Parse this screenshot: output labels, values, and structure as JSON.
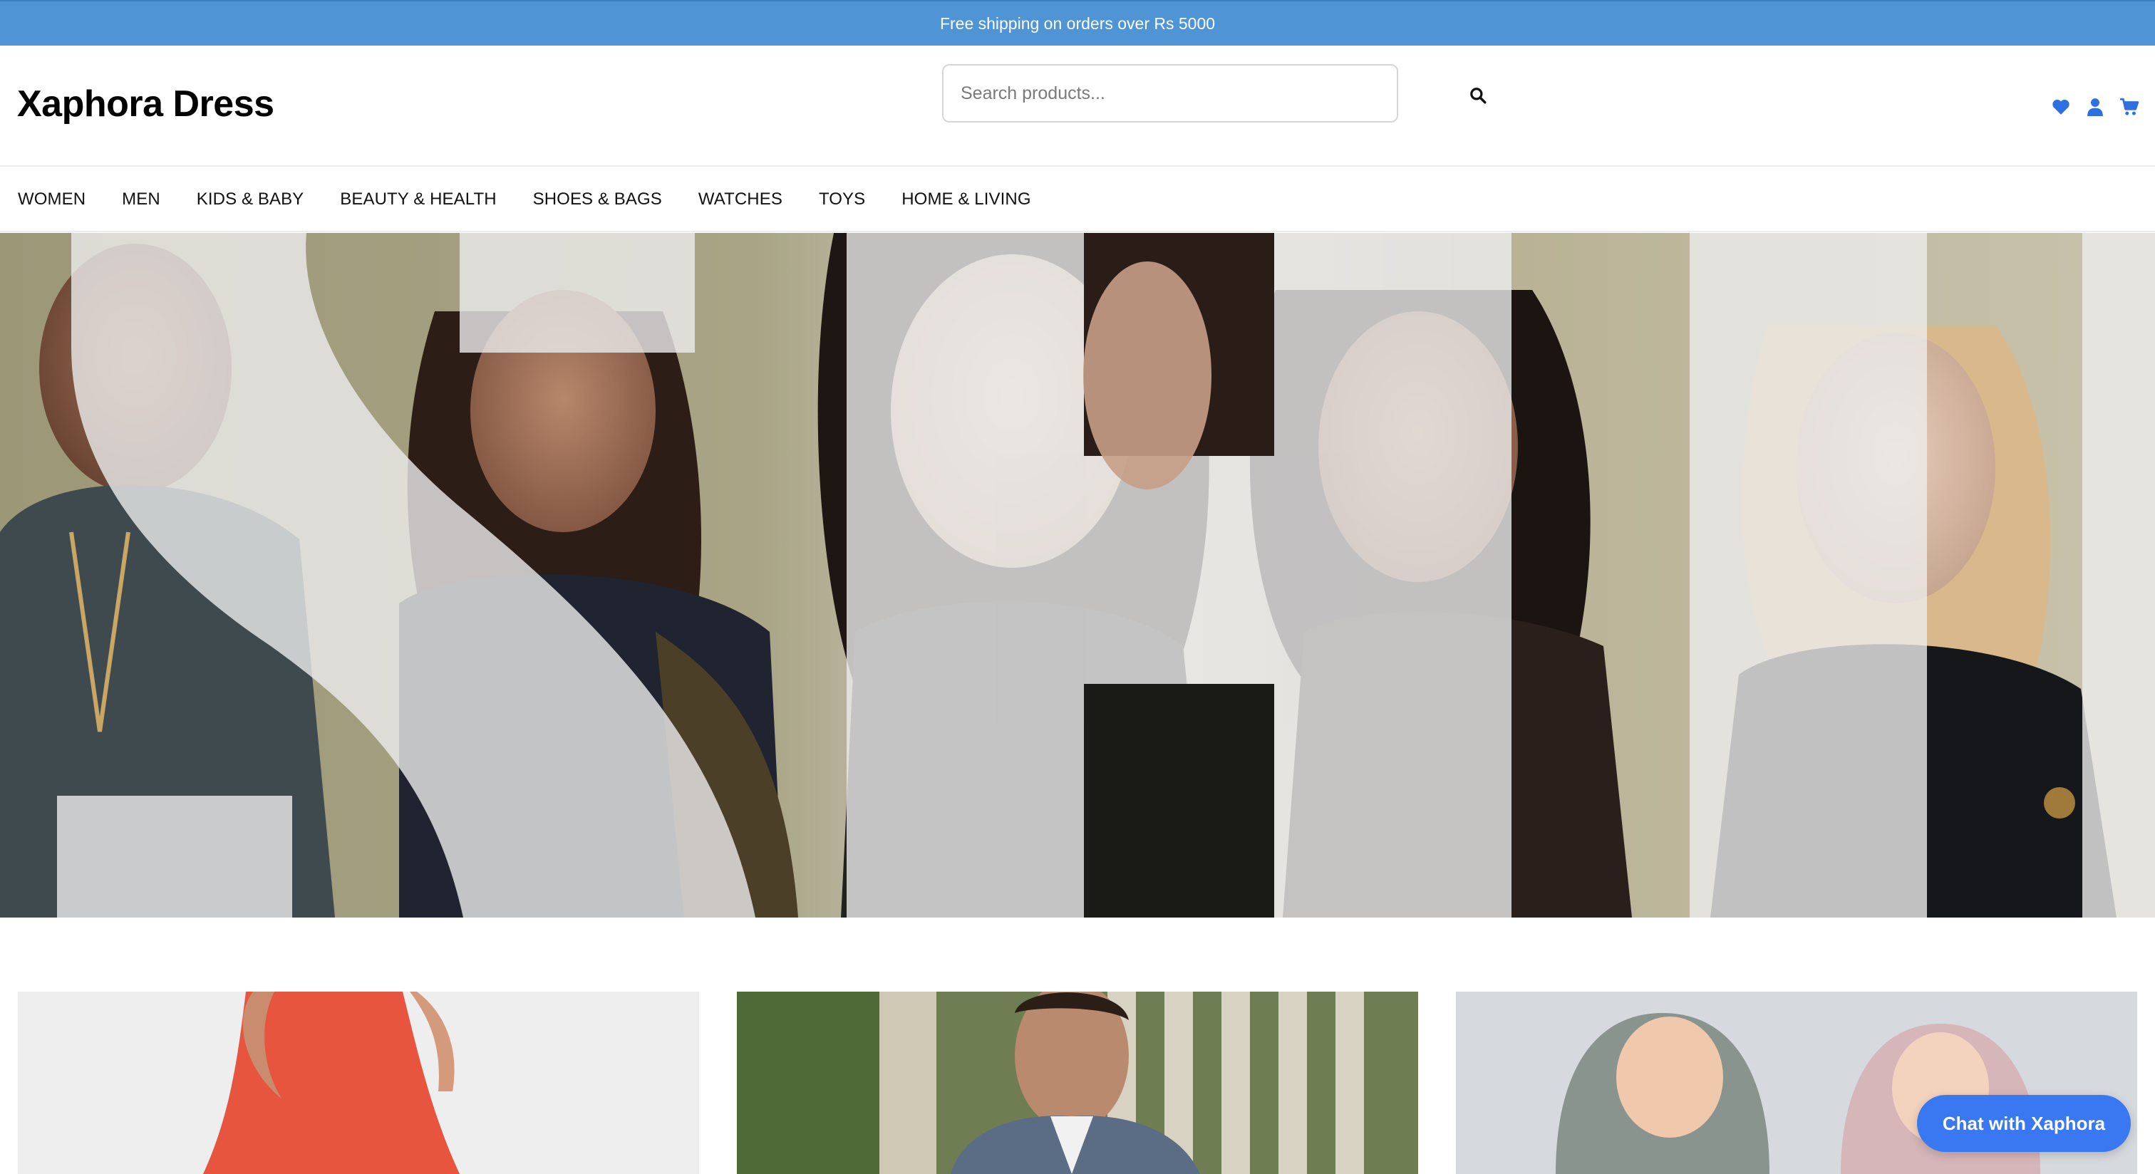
{
  "announcement": {
    "text": "Free shipping on orders over Rs 5000"
  },
  "header": {
    "logo": "Xaphora Dress",
    "search_placeholder": "Search products...",
    "icons": [
      "search-icon",
      "heart-icon",
      "user-icon",
      "cart-icon"
    ]
  },
  "nav": {
    "items": [
      {
        "label": "WOMEN"
      },
      {
        "label": "MEN"
      },
      {
        "label": "KIDS & BABY"
      },
      {
        "label": "BEAUTY & HEALTH"
      },
      {
        "label": "SHOES & BAGS"
      },
      {
        "label": "WATCHES"
      },
      {
        "label": "TOYS"
      },
      {
        "label": "HOME & LIVING"
      }
    ]
  },
  "hero": {
    "image": "fashion models collage with large translucent letterforms"
  },
  "categories": [
    {
      "image": "woman in red dress"
    },
    {
      "image": "man in blazer and sunglasses"
    },
    {
      "image": "two toddlers in hoodies"
    }
  ],
  "chat": {
    "label": "Chat with Xaphora"
  },
  "colors": {
    "announcement_bg": "#4f94d4",
    "accent": "#3a78f2",
    "icon_blue": "#2f6fe0"
  }
}
